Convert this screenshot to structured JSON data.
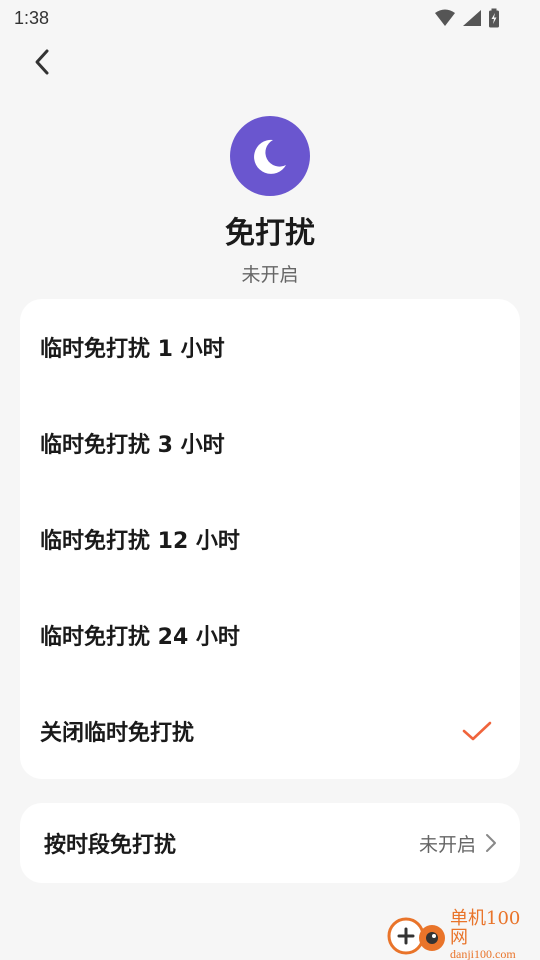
{
  "status_bar": {
    "time": "1:38"
  },
  "header": {
    "title": "免打扰",
    "status": "未开启",
    "icon": "moon-icon",
    "icon_bg_color": "#6a56cf"
  },
  "options": [
    {
      "label": "临时免打扰 1 小时",
      "selected": false
    },
    {
      "label": "临时免打扰 3 小时",
      "selected": false
    },
    {
      "label": "临时免打扰 12 小时",
      "selected": false
    },
    {
      "label": "临时免打扰 24 小时",
      "selected": false
    },
    {
      "label": "关闭临时免打扰",
      "selected": true
    }
  ],
  "schedule": {
    "label": "按时段免打扰",
    "value": "未开启"
  },
  "colors": {
    "accent": "#f0643c",
    "background": "#f6f6f6"
  },
  "watermark": {
    "text_cn": "单机100网",
    "text_url": "danji100.com"
  }
}
